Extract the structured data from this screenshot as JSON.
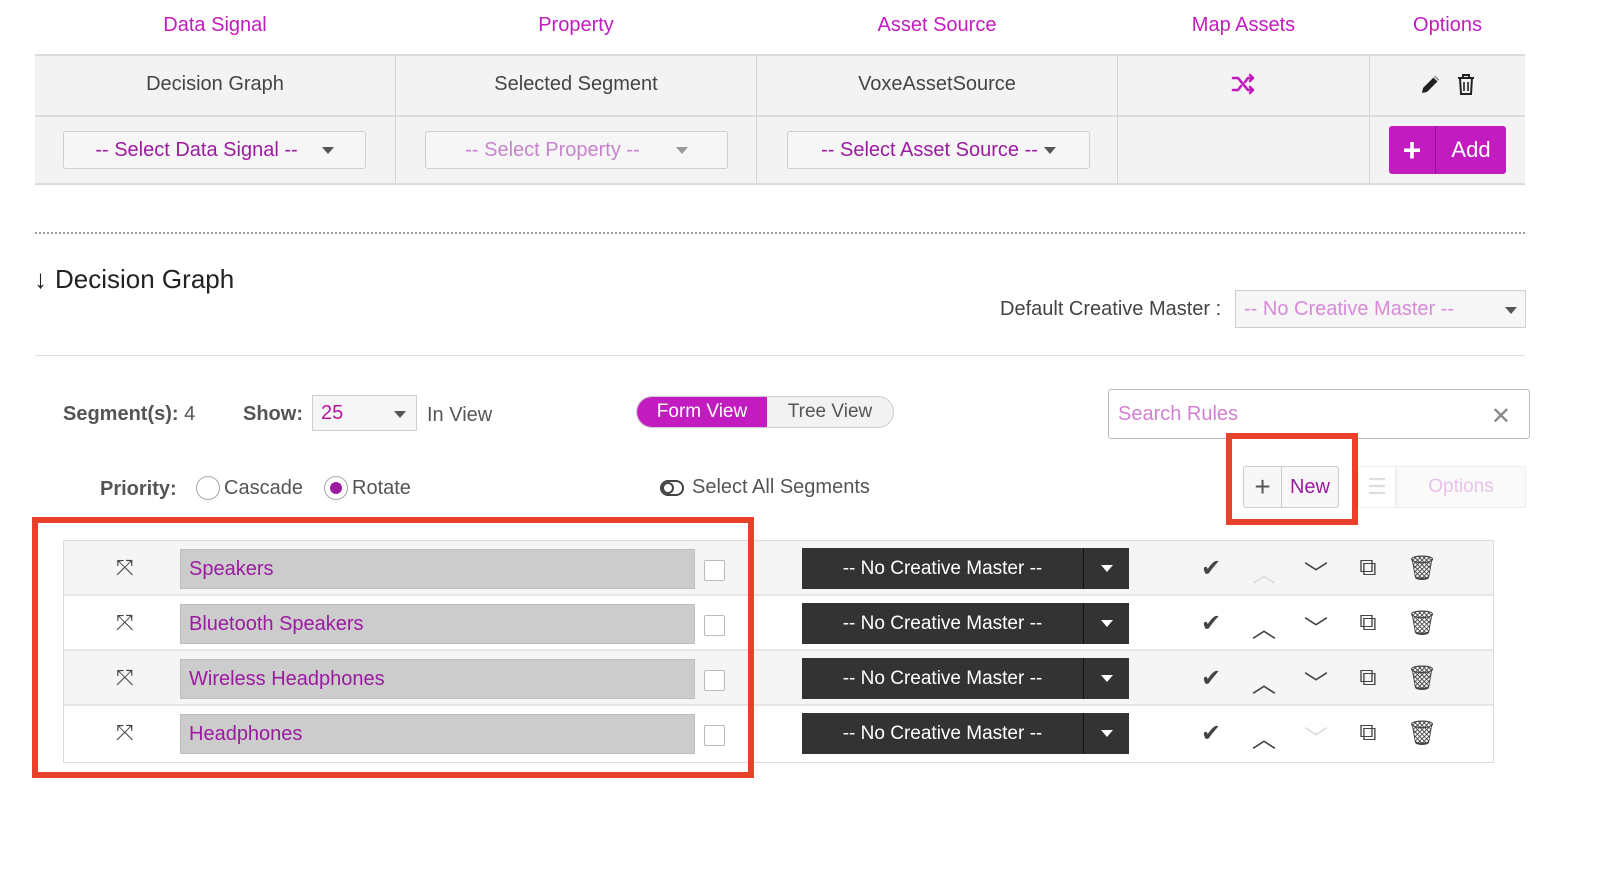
{
  "mapping_table": {
    "headers": [
      "Data Signal",
      "Property",
      "Asset Source",
      "Map Assets",
      "Options"
    ],
    "row": {
      "data_signal": "Decision Graph",
      "property": "Selected Segment",
      "asset_source": "VoxeAssetSource",
      "map_icon": "shuffle-icon",
      "edit_icon": "pencil-icon",
      "delete_icon": "trash-icon"
    },
    "new_row": {
      "data_signal_placeholder": "-- Select Data Signal --",
      "property_placeholder": "-- Select Property --",
      "asset_source_placeholder": "-- Select Asset Source --",
      "add_plus": "+",
      "add_label": "Add"
    }
  },
  "section": {
    "arrow": "↓",
    "title": "Decision Graph",
    "default_master_label": "Default Creative Master :",
    "default_master_value": "-- No Creative Master --"
  },
  "controls": {
    "segments_label": "Segment(s):",
    "segments_count": "4",
    "show_label": "Show:",
    "show_value": "25",
    "in_view": "In View",
    "form_view": "Form View",
    "tree_view": "Tree View",
    "search_placeholder": "Search Rules",
    "search_clear": "✕",
    "priority_label": "Priority:",
    "priority_options": [
      "Cascade",
      "Rotate"
    ],
    "priority_selected": "Rotate",
    "select_all": "Select All Segments",
    "new_plus": "+",
    "new_label": "New",
    "list_icon": "☰",
    "options_label": "Options"
  },
  "segments": [
    {
      "name": "Speakers",
      "master": "-- No Creative Master --",
      "up_enabled": false,
      "down_enabled": true
    },
    {
      "name": "Bluetooth Speakers",
      "master": "-- No Creative Master --",
      "up_enabled": true,
      "down_enabled": true
    },
    {
      "name": "Wireless Headphones",
      "master": "-- No Creative Master --",
      "up_enabled": true,
      "down_enabled": true
    },
    {
      "name": "Headphones",
      "master": "-- No Creative Master --",
      "up_enabled": true,
      "down_enabled": false
    }
  ],
  "colors": {
    "accent": "#c21bbf",
    "highlight": "#e8412b",
    "dark_select": "#333333"
  }
}
